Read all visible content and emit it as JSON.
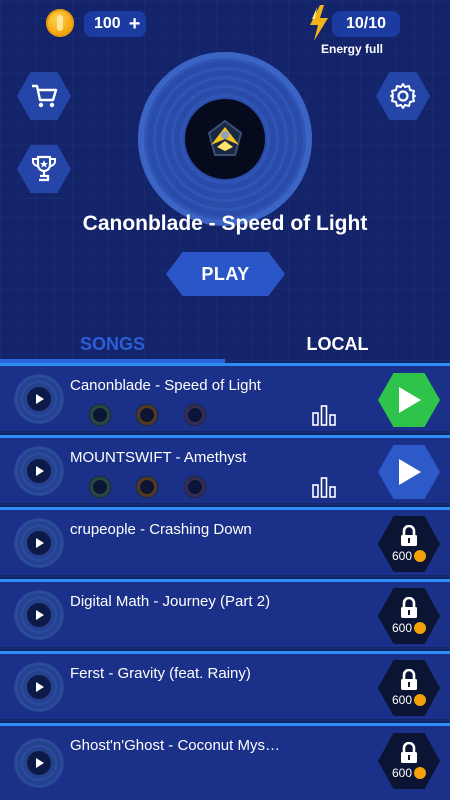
{
  "header": {
    "coins": "100",
    "coins_plus": "+",
    "energy": "10/10",
    "energy_status": "Energy full"
  },
  "now_playing": {
    "title": "Canonblade - Speed of Light",
    "play_label": "PLAY"
  },
  "tabs": [
    {
      "label": "SONGS",
      "active": true
    },
    {
      "label": "LOCAL",
      "active": false
    }
  ],
  "songs": [
    {
      "title": "Canonblade - Speed of Light",
      "status": "selected"
    },
    {
      "title": "MOUNTSWIFT - Amethyst",
      "status": "unlocked"
    },
    {
      "title": "crupeople - Crashing Down",
      "status": "locked",
      "price": "600"
    },
    {
      "title": "Digital Math - Journey (Part 2)",
      "status": "locked",
      "price": "600"
    },
    {
      "title": "Ferst - Gravity (feat. Rainy)",
      "status": "locked",
      "price": "600"
    },
    {
      "title": "Ghost'n'Ghost - Coconut Mys…",
      "status": "locked",
      "price": "600"
    }
  ],
  "colors": {
    "background": "#13246a",
    "accent_blue": "#2d5ac9",
    "selected_green": "#2ec34b",
    "row_divider": "#2f8ef2",
    "coin_gold": "#f3a20a"
  }
}
